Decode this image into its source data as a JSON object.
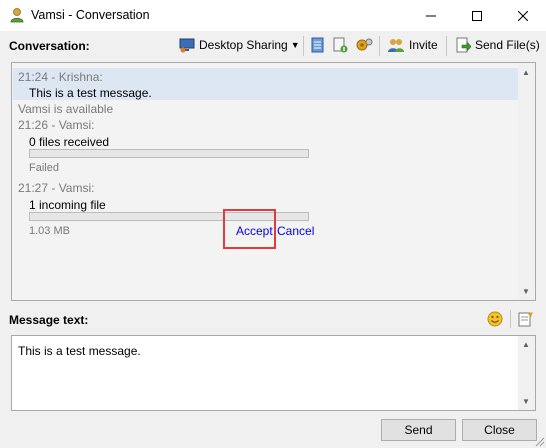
{
  "window": {
    "title": "Vamsi - Conversation"
  },
  "toolbar": {
    "section_label": "Conversation:",
    "desktop_sharing": "Desktop Sharing",
    "invite": "Invite",
    "send_files": "Send File(s)"
  },
  "conversation": {
    "messages": [
      {
        "header": "21:24 - Krishna:",
        "body": "This is a test message."
      },
      {
        "status": "Vamsi is available"
      },
      {
        "header": "21:26 - Vamsi:",
        "body": "0 files received",
        "state": "Failed"
      },
      {
        "header": "21:27 - Vamsi:",
        "body": "1 incoming file",
        "size": "1.03 MB",
        "accept": "Accept",
        "cancel": "Cancel"
      }
    ]
  },
  "message_section": {
    "label": "Message text:",
    "text": "This is a test message."
  },
  "buttons": {
    "send": "Send",
    "close": "Close"
  },
  "colors": {
    "highlight_row": "#dde7f3",
    "link": "#0000ee",
    "annotation": "#e23b3b"
  }
}
